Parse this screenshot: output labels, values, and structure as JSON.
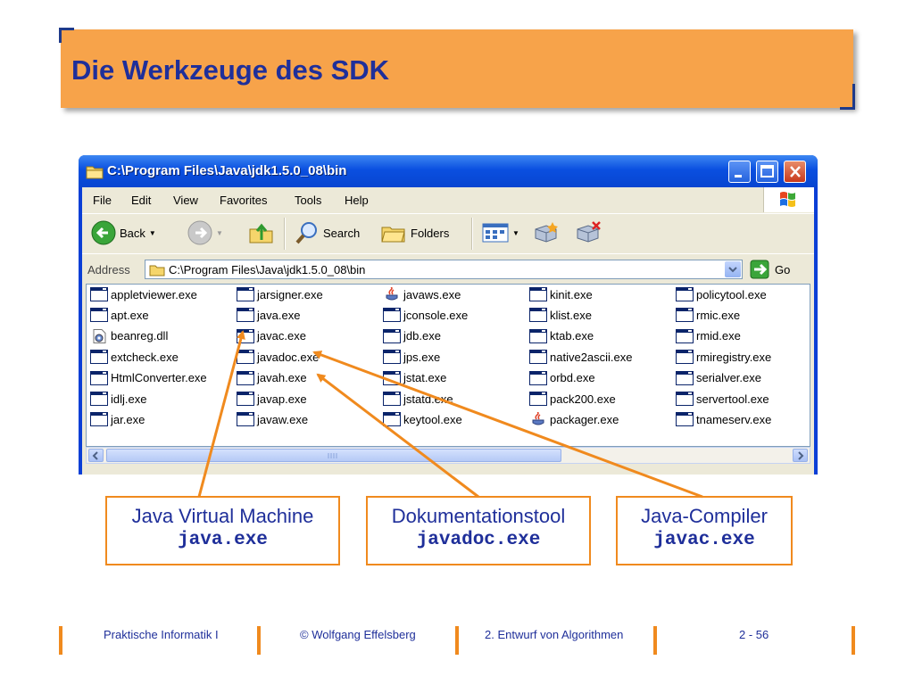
{
  "slide": {
    "title": "Die Werkzeuge des SDK"
  },
  "window": {
    "title": "C:\\Program Files\\Java\\jdk1.5.0_08\\bin",
    "menu": [
      {
        "label": "File"
      },
      {
        "label": "Edit"
      },
      {
        "label": "View"
      },
      {
        "label": "Favorites"
      },
      {
        "label": "Tools"
      },
      {
        "label": "Help"
      }
    ],
    "toolbar": {
      "back": "Back",
      "search": "Search",
      "folders": "Folders"
    },
    "address": {
      "label": "Address",
      "value": "C:\\Program Files\\Java\\jdk1.5.0_08\\bin",
      "go": "Go"
    },
    "columns": [
      [
        "appletviewer.exe",
        "apt.exe",
        "beanreg.dll",
        "extcheck.exe",
        "HtmlConverter.exe",
        "idlj.exe",
        "jar.exe"
      ],
      [
        "jarsigner.exe",
        "java.exe",
        "javac.exe",
        "javadoc.exe",
        "javah.exe",
        "javap.exe",
        "javaw.exe"
      ],
      [
        "javaws.exe",
        "jconsole.exe",
        "jdb.exe",
        "jps.exe",
        "jstat.exe",
        "jstatd.exe",
        "keytool.exe"
      ],
      [
        "kinit.exe",
        "klist.exe",
        "ktab.exe",
        "native2ascii.exe",
        "orbd.exe",
        "pack200.exe",
        "packager.exe"
      ],
      [
        "policytool.exe",
        "rmic.exe",
        "rmid.exe",
        "rmiregistry.exe",
        "serialver.exe",
        "servertool.exe",
        "tnameserv.exe"
      ]
    ],
    "icon_types": [
      [
        "exe",
        "exe",
        "dll",
        "exe",
        "exe",
        "exe",
        "exe"
      ],
      [
        "exe",
        "exe",
        "exe",
        "exe",
        "exe",
        "exe",
        "exe"
      ],
      [
        "java",
        "exe",
        "exe",
        "exe",
        "exe",
        "exe",
        "exe"
      ],
      [
        "exe",
        "exe",
        "exe",
        "exe",
        "exe",
        "exe",
        "java"
      ],
      [
        "exe",
        "exe",
        "exe",
        "exe",
        "exe",
        "exe",
        "exe"
      ]
    ]
  },
  "callouts": [
    {
      "caption": "Java Virtual Machine",
      "command": "java.exe"
    },
    {
      "caption": "Dokumentationstool",
      "command": "javadoc.exe"
    },
    {
      "caption": "Java-Compiler",
      "command": "javac.exe"
    }
  ],
  "footer": {
    "course": "Praktische Informatik I",
    "author": "© Wolfgang Effelsberg",
    "chapter": "2. Entwurf von Algorithmen",
    "page": "2 - 56"
  },
  "colors": {
    "accent": "#f7a34a",
    "title_text": "#1f2f9a",
    "callout_border": "#f08a1e",
    "xp_blue": "#0a4fe0"
  }
}
